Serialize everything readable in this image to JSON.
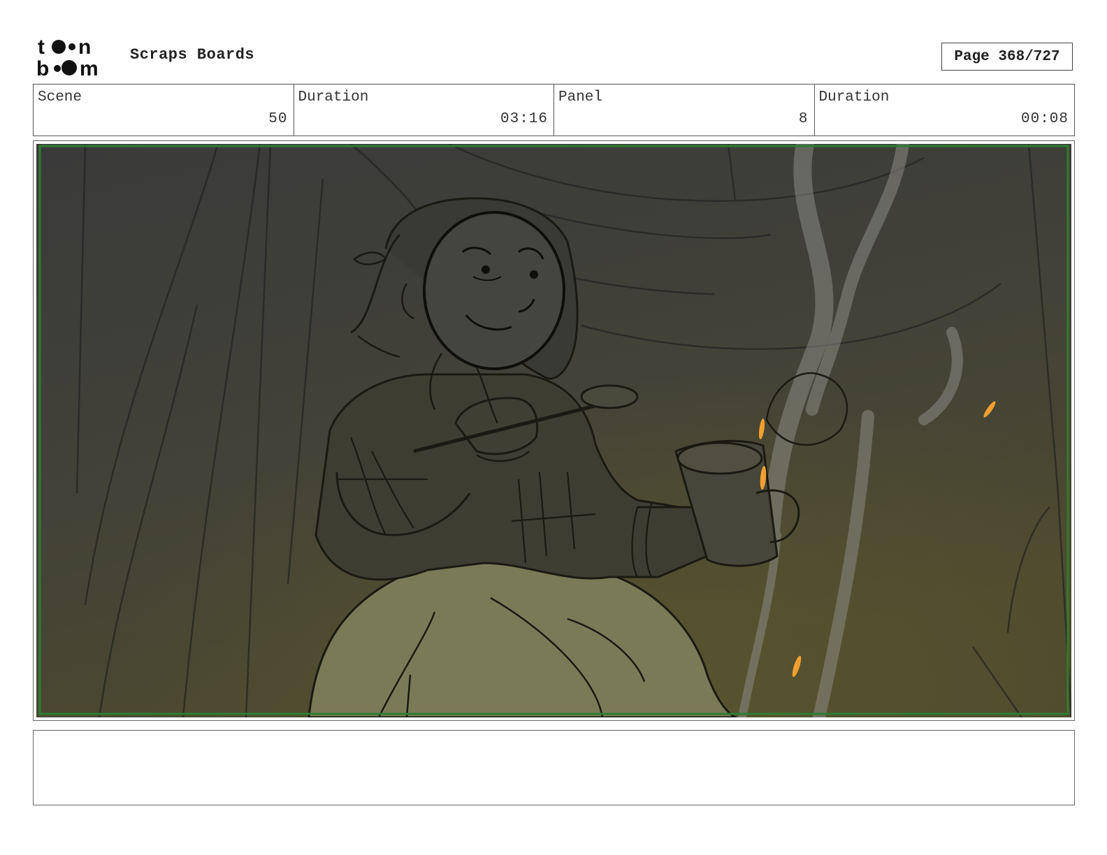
{
  "header": {
    "logo_text": "toon boom",
    "title": "Scraps Boards",
    "page_label": "Page 368/727"
  },
  "info": {
    "scene_label": "Scene",
    "scene_value": "50",
    "scene_duration_label": "Duration",
    "scene_duration_value": "03:16",
    "panel_label": "Panel",
    "panel_value": "8",
    "panel_duration_label": "Duration",
    "panel_duration_value": "00:08"
  },
  "colors": {
    "frame_border": "#2e7d32",
    "ember": "#f0a030",
    "line": "#1a1a12",
    "background_dark": "#3b3b3a"
  },
  "notes": {
    "text": ""
  }
}
